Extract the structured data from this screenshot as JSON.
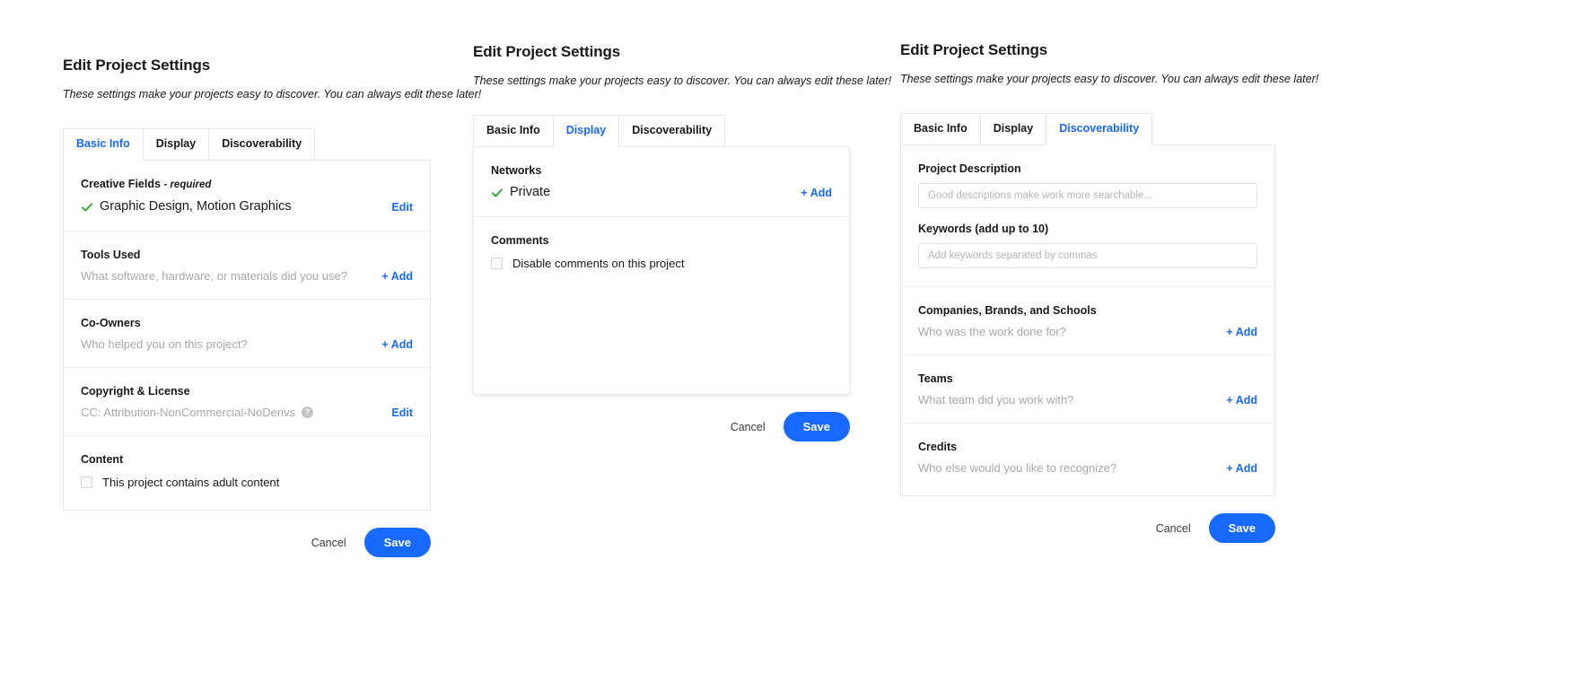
{
  "dialog": {
    "title": "Edit Project Settings",
    "subtitle": "These settings make your projects easy to discover. You can always edit these later!",
    "tabs": [
      "Basic Info",
      "Display",
      "Discoverability"
    ],
    "footer": {
      "cancel": "Cancel",
      "save": "Save"
    }
  },
  "colors": {
    "accent_blue": "#1769ff",
    "check_green": "#2aa82a",
    "text": "#191919",
    "hint": "#a8a8a8",
    "border": "#e8e8e8"
  },
  "labels": {
    "add": "+ Add",
    "edit": "Edit",
    "help": "?"
  },
  "panels": [
    {
      "active_tab": "Basic Info",
      "sections": [
        {
          "heading": "Creative Fields - required",
          "heading_plain": "Creative Fields",
          "heading_required": "- required",
          "value": "Graphic Design, Motion Graphics",
          "has_check": true,
          "action": "Edit"
        },
        {
          "heading": "Tools Used",
          "hint": "What software, hardware, or materials did you use?",
          "action": "+ Add"
        },
        {
          "heading": "Co-Owners",
          "hint": "Who helped you on this project?",
          "action": "+ Add"
        },
        {
          "heading": "Copyright & License",
          "hint": "CC: Attribution-NonCommercial-NoDerivs",
          "has_help": true,
          "action": "Edit"
        },
        {
          "heading": "Content",
          "checkbox_label": "This project contains adult content",
          "checked": false
        }
      ]
    },
    {
      "active_tab": "Display",
      "sections": [
        {
          "heading": "Networks",
          "value": "Private",
          "has_check": true,
          "action": "+ Add"
        },
        {
          "heading": "Comments",
          "checkbox_label": "Disable comments on this project",
          "checked": false
        }
      ]
    },
    {
      "active_tab": "Discoverability",
      "fields": [
        {
          "label": "Project Description",
          "placeholder": "Good descriptions make work more searchable...",
          "value": ""
        },
        {
          "label": "Keywords (add up to 10)",
          "placeholder": "Add keywords separated by commas",
          "value": ""
        }
      ],
      "sections": [
        {
          "heading": "Companies, Brands, and Schools",
          "hint": "Who was the work done for?",
          "action": "+ Add"
        },
        {
          "heading": "Teams",
          "hint": "What team did you work with?",
          "action": "+ Add"
        },
        {
          "heading": "Credits",
          "hint": "Who else would you like to recognize?",
          "action": "+ Add"
        }
      ]
    }
  ]
}
